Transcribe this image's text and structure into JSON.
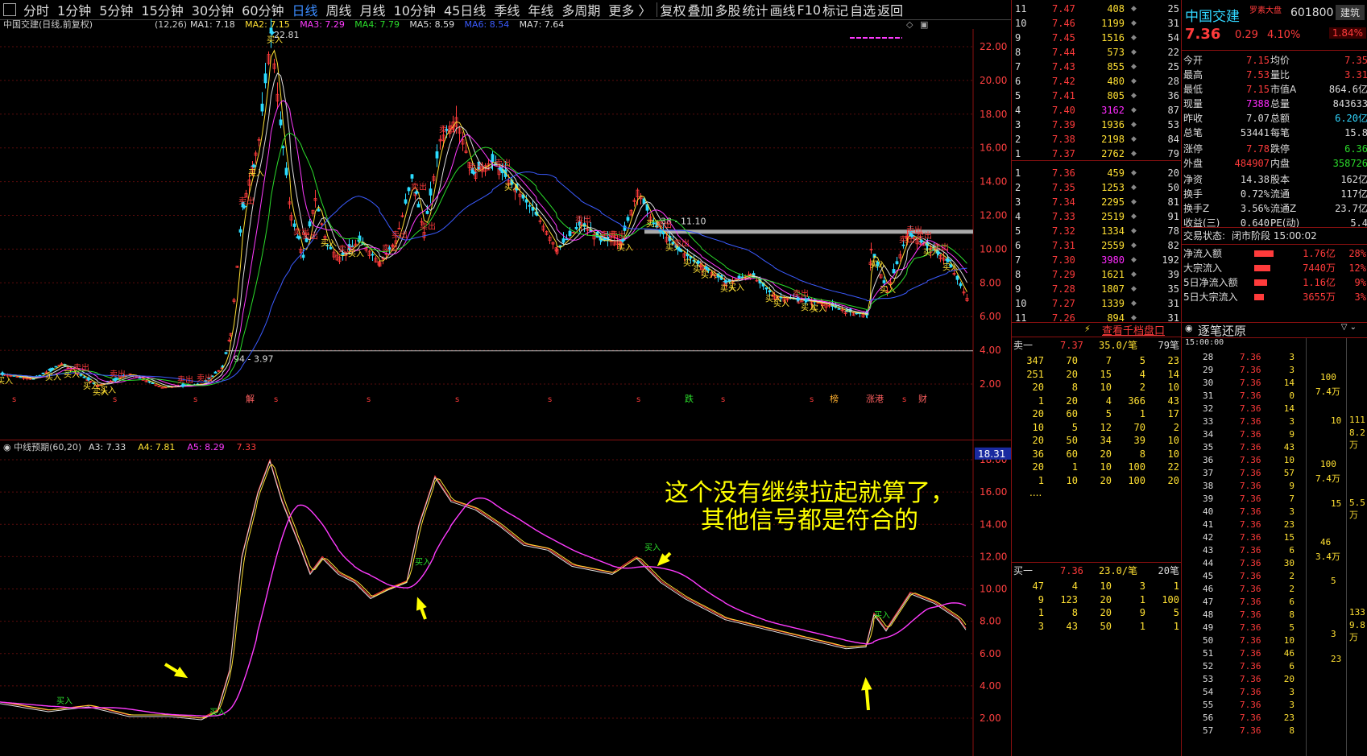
{
  "toolbar": {
    "tabs": [
      "分时",
      "1分钟",
      "5分钟",
      "15分钟",
      "30分钟",
      "60分钟",
      "日线",
      "周线",
      "月线",
      "10分钟",
      "45日线",
      "季线",
      "年线",
      "多周期",
      "更多 〉"
    ],
    "active_tab": "日线",
    "actions": [
      "复权",
      "叠加",
      "多股",
      "统计",
      "画线",
      "F10",
      "标记",
      "自选",
      "返回"
    ]
  },
  "main_info": {
    "title": "中国交建(日线,前复权)",
    "params": "(12,26)",
    "ma": [
      {
        "label": "MA1: 7.18",
        "color": "#dddddd"
      },
      {
        "label": "MA2: 7.15",
        "color": "#ffe033"
      },
      {
        "label": "MA3: 7.29",
        "color": "#ff3bff"
      },
      {
        "label": "MA4: 7.79",
        "color": "#2bdc2b"
      },
      {
        "label": "MA5: 8.59",
        "color": "#dddddd"
      },
      {
        "label": "MA6: 8.54",
        "color": "#3b5bff"
      },
      {
        "label": "MA7: 7.64",
        "color": "#dddddd"
      }
    ],
    "peak_label": "22.81",
    "resist_label": "38 - 11.10",
    "support_label": "94 - 3.97",
    "y_ticks": [
      "22.00",
      "20.00",
      "18.00",
      "16.00",
      "14.00",
      "12.00",
      "10.00",
      "8.00",
      "6.00",
      "4.00",
      "2.00"
    ],
    "events": [
      "解",
      "跌",
      "榜",
      "涨港",
      "财"
    ]
  },
  "sub_info": {
    "title": "中线预期(60,20)",
    "items": [
      {
        "label": "A3: 7.33",
        "color": "#dddddd"
      },
      {
        "label": "A4: 7.81",
        "color": "#ffe033"
      },
      {
        "label": "A5: 8.29",
        "color": "#ff3bff"
      },
      {
        "label": "7.33",
        "color": "#ff3b3b"
      }
    ],
    "highlight": "18.31",
    "y_ticks": [
      "18.00",
      "16.00",
      "14.00",
      "12.00",
      "10.00",
      "8.00",
      "6.00",
      "4.00",
      "2.00"
    ]
  },
  "annotation": "这个没有继续拉起就算了，其他信号都是符合的",
  "buy_label": "买入",
  "sell_label": "卖出",
  "order_book": {
    "asks": [
      {
        "lvl": "11",
        "price": "7.47",
        "vol": "408",
        "n": "25"
      },
      {
        "lvl": "10",
        "price": "7.46",
        "vol": "1199",
        "n": "31"
      },
      {
        "lvl": "9",
        "price": "7.45",
        "vol": "1516",
        "n": "54"
      },
      {
        "lvl": "8",
        "price": "7.44",
        "vol": "573",
        "n": "22"
      },
      {
        "lvl": "7",
        "price": "7.43",
        "vol": "855",
        "n": "25"
      },
      {
        "lvl": "6",
        "price": "7.42",
        "vol": "480",
        "n": "28"
      },
      {
        "lvl": "5",
        "price": "7.41",
        "vol": "805",
        "n": "36"
      },
      {
        "lvl": "4",
        "price": "7.40",
        "vol": "3162",
        "n": "87"
      },
      {
        "lvl": "3",
        "price": "7.39",
        "vol": "1936",
        "n": "53"
      },
      {
        "lvl": "2",
        "price": "7.38",
        "vol": "2198",
        "n": "84"
      },
      {
        "lvl": "1",
        "price": "7.37",
        "vol": "2762",
        "n": "79"
      }
    ],
    "bids": [
      {
        "lvl": "1",
        "price": "7.36",
        "vol": "459",
        "n": "20"
      },
      {
        "lvl": "2",
        "price": "7.35",
        "vol": "1253",
        "n": "50"
      },
      {
        "lvl": "3",
        "price": "7.34",
        "vol": "2295",
        "n": "81"
      },
      {
        "lvl": "4",
        "price": "7.33",
        "vol": "2519",
        "n": "91"
      },
      {
        "lvl": "5",
        "price": "7.32",
        "vol": "1334",
        "n": "78"
      },
      {
        "lvl": "6",
        "price": "7.31",
        "vol": "2559",
        "n": "82"
      },
      {
        "lvl": "7",
        "price": "7.30",
        "vol": "3980",
        "n": "192"
      },
      {
        "lvl": "8",
        "price": "7.29",
        "vol": "1621",
        "n": "39"
      },
      {
        "lvl": "9",
        "price": "7.28",
        "vol": "1807",
        "n": "35"
      },
      {
        "lvl": "10",
        "price": "7.27",
        "vol": "1339",
        "n": "31"
      },
      {
        "lvl": "11",
        "price": "7.26",
        "vol": "894",
        "n": "31"
      }
    ]
  },
  "quote": {
    "name": "中国交建",
    "tag": "罗素大盘",
    "code": "601800",
    "button": "建筑",
    "price": "7.36",
    "change": "0.29",
    "pct": "4.10%",
    "pct2": "1.84%",
    "fields": [
      [
        "今开",
        "7.15",
        "均价",
        "7.35"
      ],
      [
        "最高",
        "7.53",
        "量比",
        "3.31"
      ],
      [
        "最低",
        "7.15",
        "市值A",
        "864.6亿"
      ],
      [
        "现量",
        "7388",
        "总量",
        "843633"
      ],
      [
        "昨收",
        "7.07",
        "总额",
        "6.20亿"
      ],
      [
        "总笔",
        "53441",
        "每笔",
        "15.8"
      ],
      [
        "涨停",
        "7.78",
        "跌停",
        "6.36"
      ],
      [
        "外盘",
        "484907",
        "内盘",
        "358726"
      ],
      [
        "净资",
        "14.38",
        "股本",
        "162亿"
      ],
      [
        "换手",
        "0.72%",
        "流通",
        "117亿"
      ],
      [
        "换手Z",
        "3.56%",
        "流通Z",
        "23.7亿"
      ],
      [
        "收益(三)",
        "0.640",
        "PE(动)",
        "5.4"
      ]
    ],
    "status_label": "交易状态:",
    "status": "闭市阶段 15:00:02",
    "flows": [
      [
        "净流入额",
        "1.76亿",
        "28%"
      ],
      [
        "大宗流入",
        "7440万",
        "12%"
      ],
      [
        "5日净流入额",
        "1.16亿",
        "9%"
      ],
      [
        "5日大宗流入",
        "3655万",
        "3%"
      ]
    ]
  },
  "thousand": {
    "header": "查看千档盘口",
    "sell_head": [
      "卖一",
      "7.37",
      "35.0/笔",
      "79笔"
    ],
    "sell_rows": [
      [
        "347",
        "70",
        "7",
        "5",
        "23"
      ],
      [
        "251",
        "20",
        "15",
        "4",
        "14"
      ],
      [
        "20",
        "8",
        "10",
        "2",
        "10"
      ],
      [
        "1",
        "20",
        "4",
        "366",
        "43"
      ],
      [
        "20",
        "60",
        "5",
        "1",
        "17"
      ],
      [
        "10",
        "5",
        "12",
        "70",
        "2"
      ],
      [
        "20",
        "50",
        "34",
        "39",
        "10"
      ],
      [
        "36",
        "60",
        "20",
        "8",
        "10"
      ],
      [
        "20",
        "1",
        "10",
        "100",
        "22"
      ],
      [
        "1",
        "10",
        "20",
        "100",
        "20"
      ]
    ],
    "ellipsis": "....",
    "buy_head": [
      "买一",
      "7.36",
      "23.0/笔",
      "20笔"
    ],
    "buy_rows": [
      [
        "47",
        "4",
        "10",
        "3",
        "1"
      ],
      [
        "9",
        "123",
        "20",
        "1",
        "100"
      ],
      [
        "1",
        "8",
        "20",
        "9",
        "5"
      ],
      [
        "3",
        "43",
        "50",
        "1",
        "1"
      ]
    ]
  },
  "ticks": {
    "header": "逐笔还原",
    "first_time": "15:00:00",
    "rows": [
      [
        "28",
        "7.36",
        "3"
      ],
      [
        "29",
        "7.36",
        "3"
      ],
      [
        "30",
        "7.36",
        "14"
      ],
      [
        "31",
        "7.36",
        "0"
      ],
      [
        "32",
        "7.36",
        "14"
      ],
      [
        "33",
        "7.36",
        "3"
      ],
      [
        "34",
        "7.36",
        "9"
      ],
      [
        "35",
        "7.36",
        "43"
      ],
      [
        "36",
        "7.36",
        "10"
      ],
      [
        "37",
        "7.36",
        "57"
      ],
      [
        "38",
        "7.36",
        "9"
      ],
      [
        "39",
        "7.36",
        "7"
      ],
      [
        "40",
        "7.36",
        "3"
      ],
      [
        "41",
        "7.36",
        "23"
      ],
      [
        "42",
        "7.36",
        "15"
      ],
      [
        "43",
        "7.36",
        "6"
      ],
      [
        "44",
        "7.36",
        "30"
      ],
      [
        "45",
        "7.36",
        "2"
      ],
      [
        "46",
        "7.36",
        "2"
      ],
      [
        "47",
        "7.36",
        "6"
      ],
      [
        "48",
        "7.36",
        "8"
      ],
      [
        "49",
        "7.36",
        "5"
      ],
      [
        "50",
        "7.36",
        "10"
      ],
      [
        "51",
        "7.36",
        "46"
      ],
      [
        "52",
        "7.36",
        "6"
      ],
      [
        "53",
        "7.36",
        "20"
      ],
      [
        "54",
        "7.36",
        "3"
      ],
      [
        "55",
        "7.36",
        "3"
      ],
      [
        "56",
        "7.36",
        "23"
      ],
      [
        "57",
        "7.36",
        "8"
      ]
    ],
    "groups": [
      [
        "100",
        "7.4万"
      ],
      [
        "100",
        "7.4万"
      ],
      [
        "46",
        "3.4万"
      ]
    ],
    "side_vals": [
      "10",
      "15",
      "5",
      "3",
      "23"
    ],
    "far": [
      "111",
      "8.2万",
      "5.5万",
      "133",
      "9.8万"
    ]
  }
}
